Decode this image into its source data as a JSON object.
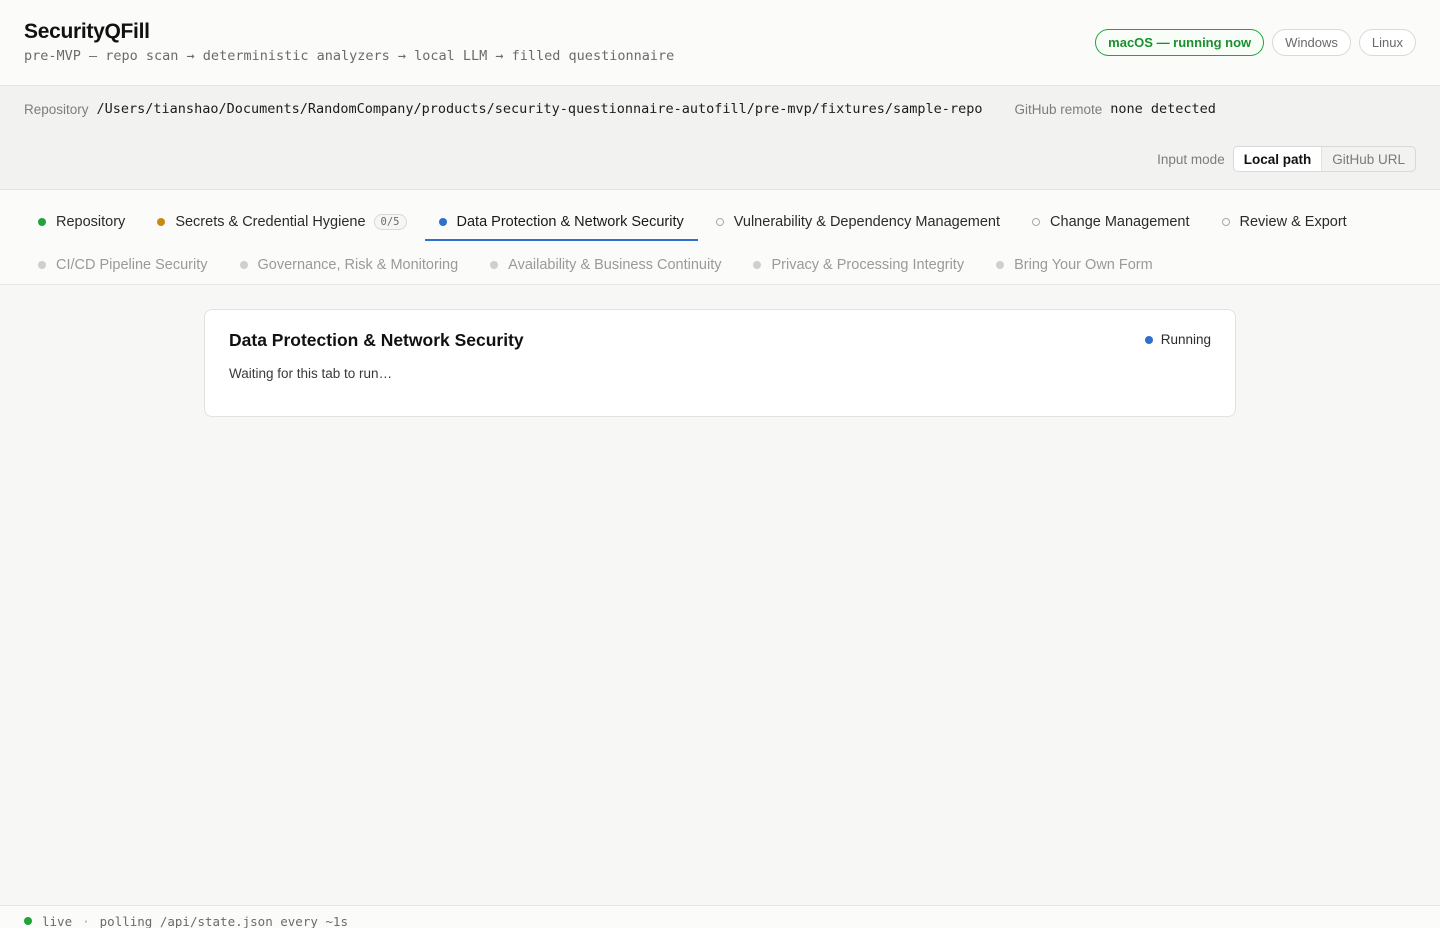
{
  "header": {
    "title": "SecurityQFill",
    "subtitle": "pre-MVP — repo scan → deterministic analyzers → local LLM → filled questionnaire",
    "os_options": [
      {
        "label": "macOS — running now",
        "active": true
      },
      {
        "label": "Windows",
        "active": false
      },
      {
        "label": "Linux",
        "active": false
      }
    ]
  },
  "repo": {
    "label": "Repository",
    "path": "/Users/tianshao/Documents/RandomCompany/products/security-questionnaire-autofill/pre-mvp/fixtures/sample-repo",
    "github_label": "GitHub remote",
    "github_value": "none detected",
    "input_mode_label": "Input mode",
    "input_modes": [
      "Local path",
      "GitHub URL"
    ]
  },
  "tabs": {
    "row1": [
      {
        "label": "Repository",
        "status": "green"
      },
      {
        "label": "Secrets & Credential Hygiene",
        "status": "amber",
        "badge": "0/5"
      },
      {
        "label": "Data Protection & Network Security",
        "status": "blue",
        "active": true
      },
      {
        "label": "Vulnerability & Dependency Management",
        "status": "hollow"
      },
      {
        "label": "Change Management",
        "status": "hollow"
      },
      {
        "label": "Review & Export",
        "status": "hollow"
      }
    ],
    "row2": [
      {
        "label": "CI/CD Pipeline Security",
        "status": "grey"
      },
      {
        "label": "Governance, Risk & Monitoring",
        "status": "grey"
      },
      {
        "label": "Availability & Business Continuity",
        "status": "grey"
      },
      {
        "label": "Privacy & Processing Integrity",
        "status": "grey"
      },
      {
        "label": "Bring Your Own Form",
        "status": "grey"
      }
    ]
  },
  "card": {
    "title": "Data Protection & Network Security",
    "status": "Running",
    "message": "Waiting for this tab to run…"
  },
  "footer": {
    "live": "live",
    "separator": "·",
    "polling": "polling /api/state.json every ~1s"
  },
  "colors": {
    "accent_blue": "#2f6fcf",
    "success_green": "#22a33a",
    "warning_amber": "#c98a12"
  }
}
